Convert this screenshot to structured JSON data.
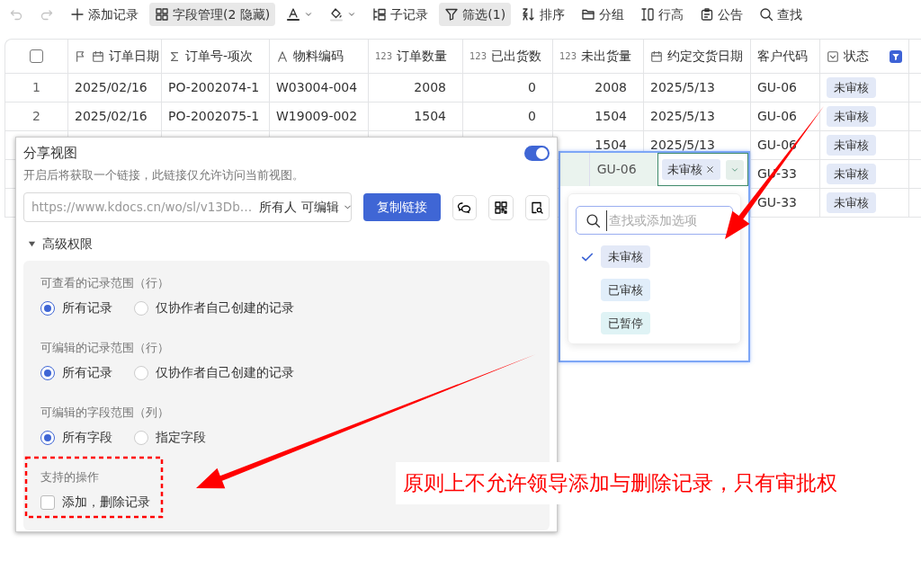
{
  "toolbar": [
    {
      "kind": "undo",
      "disabled": true,
      "active": false
    },
    {
      "kind": "redo",
      "disabled": true,
      "active": false
    },
    {
      "kind": "add",
      "label": "添加记录",
      "disabled": false,
      "active": false
    },
    {
      "kind": "fields",
      "label": "字段管理(2 隐藏)",
      "disabled": false,
      "active": true
    },
    {
      "kind": "text-color",
      "disabled": false,
      "active": false
    },
    {
      "kind": "fill-color",
      "disabled": false,
      "active": false
    },
    {
      "kind": "subrecord",
      "label": "子记录",
      "disabled": false,
      "active": false
    },
    {
      "kind": "filter",
      "label": "筛选(1)",
      "disabled": false,
      "active": true
    },
    {
      "kind": "sort",
      "label": "排序",
      "disabled": false,
      "active": false
    },
    {
      "kind": "group",
      "label": "分组",
      "disabled": false,
      "active": false
    },
    {
      "kind": "row-height",
      "label": "行高",
      "disabled": false,
      "active": false
    },
    {
      "kind": "notice",
      "label": "公告",
      "disabled": false,
      "active": false
    },
    {
      "kind": "search",
      "label": "查找",
      "disabled": false,
      "active": false
    }
  ],
  "table": {
    "columns": [
      {
        "kind": "checkbox",
        "checked": false
      },
      {
        "kind": "date-flag",
        "label": "订单日期"
      },
      {
        "kind": "formula",
        "label": "订单号-项次"
      },
      {
        "kind": "text",
        "label": "物料编码"
      },
      {
        "kind": "number",
        "type_label": "123",
        "label": "订单数量"
      },
      {
        "kind": "number",
        "type_label": "123",
        "label": "已出货数"
      },
      {
        "kind": "number",
        "type_label": "123",
        "label": "未出货量"
      },
      {
        "kind": "date",
        "label": "约定交货日期"
      },
      {
        "kind": "plain",
        "label": "客户代码"
      },
      {
        "kind": "select",
        "label": "状态",
        "filtered": true
      }
    ],
    "rows": [
      {
        "cells": [
          "1",
          "2025/02/16",
          "PO-2002074-1",
          "W03004-004",
          "2008",
          "0",
          "2008",
          "2025/5/13",
          "GU-06",
          "未审核"
        ]
      },
      {
        "cells": [
          "2",
          "2025/02/16",
          "PO-2002075-1",
          "W19009-002",
          "1504",
          "0",
          "1504",
          "2025/5/13",
          "GU-06",
          "未审核"
        ]
      },
      {
        "cells": [
          null,
          null,
          null,
          null,
          null,
          null,
          "1504",
          "2025/5/13",
          "GU-06",
          "未审核"
        ]
      },
      {
        "cells": [
          null,
          null,
          null,
          null,
          null,
          null,
          null,
          null,
          "GU-33",
          "未审核"
        ]
      },
      {
        "cells": [
          null,
          null,
          null,
          null,
          null,
          null,
          null,
          null,
          "GU-33",
          "未审核"
        ]
      }
    ]
  },
  "share_panel": {
    "title": "分享视图",
    "enabled": true,
    "description": "开启后将获取一个链接，此链接仅允许访问当前视图。",
    "link": "https://www.kdocs.cn/wo/sl/v13Db…",
    "permission": "所有人 可编辑",
    "copy_button": "复制链接",
    "share_icons": [
      {
        "kind": "chat"
      },
      {
        "kind": "qrcode"
      },
      {
        "kind": "preview"
      }
    ],
    "advanced": {
      "label": "高级权限",
      "expanded": true,
      "sections": [
        {
          "kind": "radio",
          "label": "可查看的记录范围（行）",
          "options": [
            {
              "label": "所有记录",
              "selected": true
            },
            {
              "label": "仅协作者自己创建的记录",
              "selected": false
            }
          ]
        },
        {
          "kind": "radio",
          "label": "可编辑的记录范围（行）",
          "options": [
            {
              "label": "所有记录",
              "selected": true
            },
            {
              "label": "仅协作者自己创建的记录",
              "selected": false
            }
          ]
        },
        {
          "kind": "radio",
          "label": "可编辑的字段范围（列）",
          "options": [
            {
              "label": "所有字段",
              "selected": true
            },
            {
              "label": "指定字段",
              "selected": false
            }
          ]
        },
        {
          "kind": "checkbox",
          "label": "支持的操作",
          "options": [
            {
              "label": "添加，删除记录",
              "checked": false
            }
          ]
        }
      ]
    }
  },
  "cell_editor": {
    "cell": "GU-06",
    "value_tag": "未审核",
    "search_placeholder": "查找或添加选项",
    "options": [
      {
        "label": "未审核",
        "selected": true,
        "color": "#e3e9f7"
      },
      {
        "label": "已审核",
        "selected": false,
        "color": "#e1eefa"
      },
      {
        "label": "已暂停",
        "selected": false,
        "color": "#dff3f5"
      }
    ]
  },
  "annotation": {
    "note": "原则上不允许领导添加与删除记录，只有审批权"
  }
}
